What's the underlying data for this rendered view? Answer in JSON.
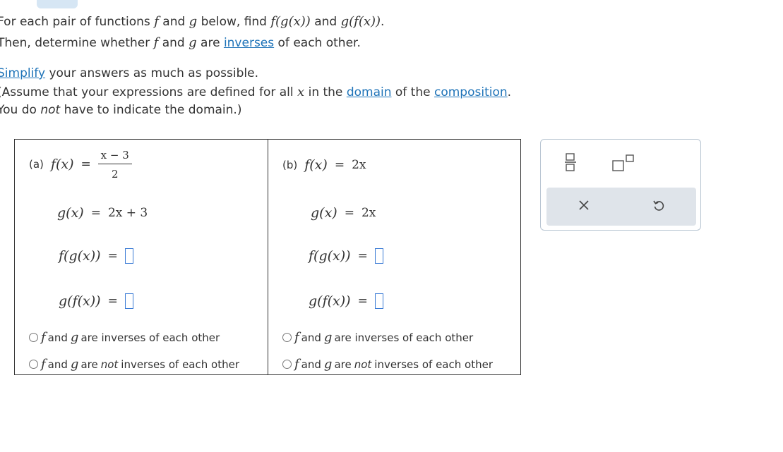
{
  "instructions": {
    "line1": {
      "t1": "For each pair of functions",
      "f": "f",
      "t2": "and",
      "g": "g",
      "t3": "below, find",
      "fog": "f(g(x))",
      "t4": "and",
      "gof": "g(f(x))",
      "t5": "."
    },
    "line2": {
      "t1": "Then, determine whether",
      "f": "f",
      "t2": "and",
      "g": "g",
      "t3": "are",
      "link": "inverses",
      "t4": "of each other."
    },
    "line3": {
      "link": "Simplify",
      "t1": "your answers as much as possible."
    },
    "line4": {
      "t1": "(Assume that your expressions are defined for all",
      "x": "x",
      "t2": "in the",
      "link1": "domain",
      "t3": "of the",
      "link2": "composition",
      "t4": "."
    },
    "line5": {
      "t1": "You do",
      "em": "not",
      "t2": "have to indicate the domain.)"
    }
  },
  "parts": [
    {
      "label": "(a)",
      "f_lhs": "f(x)",
      "f_num": "x − 3",
      "f_den": "2",
      "g_lhs": "g(x)",
      "g_rhs": "2x + 3",
      "fog_lhs": "f(g(x))",
      "gof_lhs": "g(f(x))",
      "eq": "=",
      "opt1": {
        "f": "f",
        "and": "and",
        "g": "g",
        "rest": "are inverses of each other"
      },
      "opt2": {
        "f": "f",
        "and": "and",
        "g": "g",
        "pre": "are",
        "em": "not",
        "rest": "inverses of each other"
      }
    },
    {
      "label": "(b)",
      "f_lhs": "f(x)",
      "f_rhs": "2x",
      "g_lhs": "g(x)",
      "g_rhs": "2x",
      "fog_lhs": "f(g(x))",
      "gof_lhs": "g(f(x))",
      "eq": "=",
      "opt1": {
        "f": "f",
        "and": "and",
        "g": "g",
        "rest": "are inverses of each other"
      },
      "opt2": {
        "f": "f",
        "and": "and",
        "g": "g",
        "pre": "are",
        "em": "not",
        "rest": "inverses of each other"
      }
    }
  ],
  "palette": {
    "tools": [
      "fraction-icon",
      "exponent-icon"
    ],
    "actions": [
      "clear-icon",
      "undo-icon"
    ]
  },
  "colors": {
    "link": "#1e73b8",
    "box": "#3a7bd5",
    "palette_bg": "#dfe4ea",
    "tab": "#d6e6f4"
  }
}
